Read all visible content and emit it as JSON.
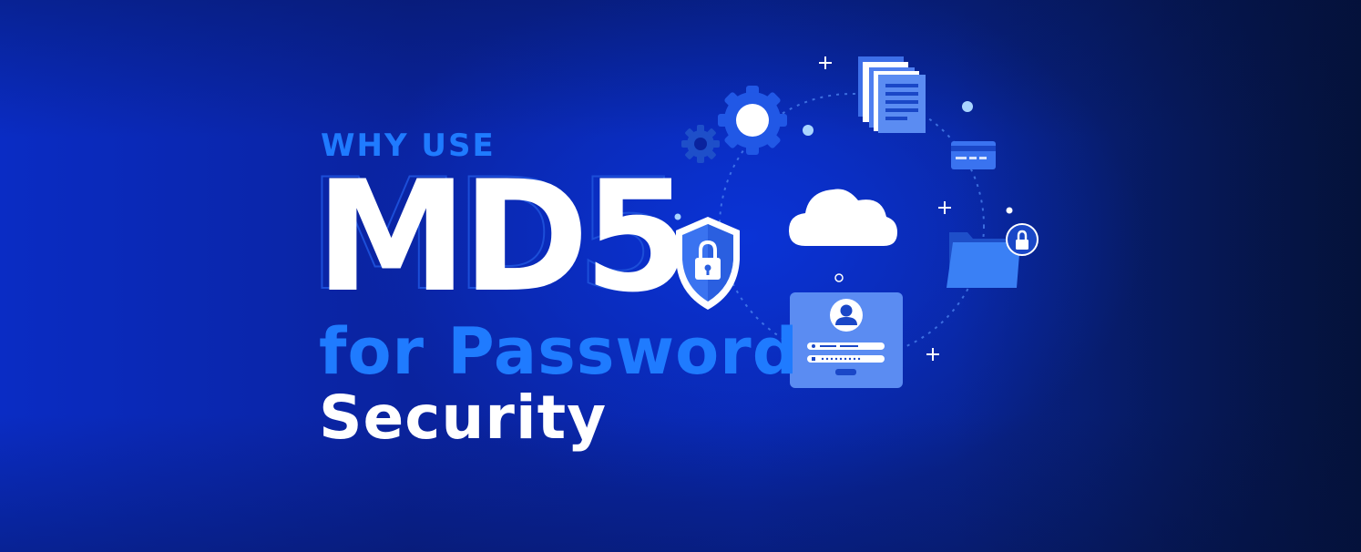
{
  "headline": {
    "eyebrow": "WHY USE",
    "main": "MD5",
    "line2": "for Password",
    "line3": "Security"
  },
  "colors": {
    "accent": "#1f7bff",
    "background": "#0a239e",
    "card": "#5b8cf2",
    "text": "#ffffff"
  },
  "icons": [
    "gear-icon",
    "document-stack-icon",
    "credit-card-icon",
    "cloud-icon",
    "shield-lock-icon",
    "folder-lock-icon",
    "login-card-icon",
    "user-icon",
    "padlock-icon"
  ]
}
